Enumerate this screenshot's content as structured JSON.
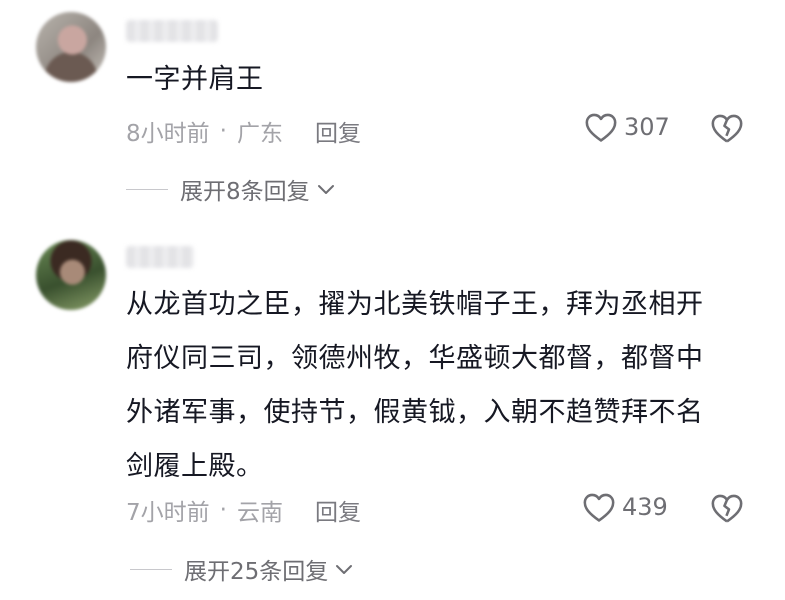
{
  "comments": [
    {
      "text_lines": [
        "一字并肩王"
      ],
      "time": "8小时前",
      "separator": "·",
      "location": "广东",
      "reply_label": "回复",
      "likes": "307",
      "expand_label": "展开8条回复"
    },
    {
      "text_lines": [
        "从龙首功之臣，擢为北美铁帽子王，拜为丞相开",
        "府仪同三司，领德州牧，华盛顿大都督，都督中",
        "外诸军事，使持节，假黄钺，入朝不趋赞拜不名",
        "剑履上殿。"
      ],
      "time": "7小时前",
      "separator": "·",
      "location": "云南",
      "reply_label": "回复",
      "likes": "439",
      "expand_label": "展开25条回复"
    }
  ]
}
